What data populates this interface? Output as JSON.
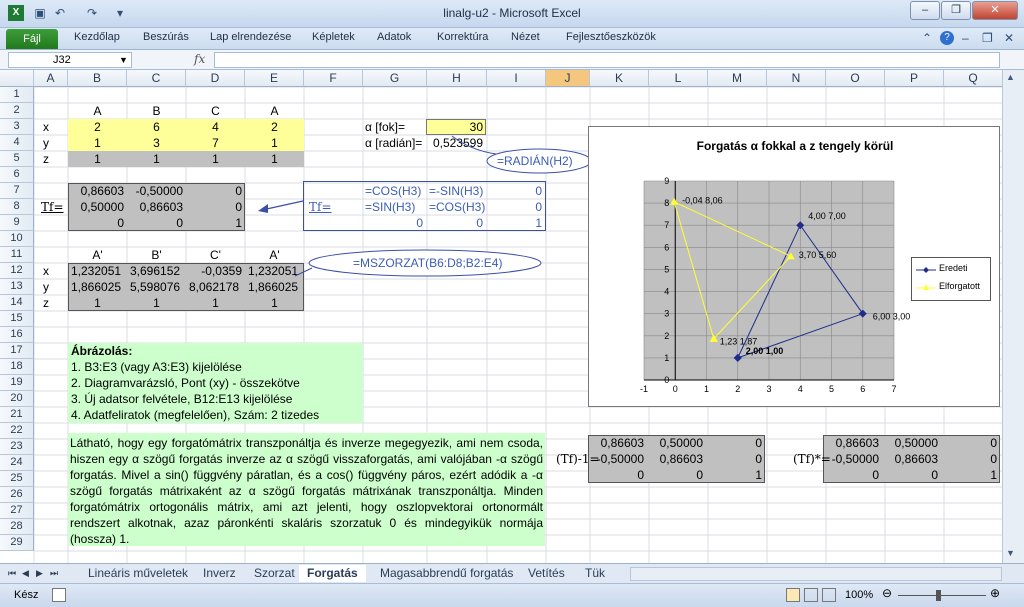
{
  "window": {
    "title": "linalg-u2 - Microsoft Excel"
  },
  "ribbon": {
    "file": "Fájl",
    "tabs": [
      "Kezdőlap",
      "Beszúrás",
      "Lap elrendezése",
      "Képletek",
      "Adatok",
      "Korrektúra",
      "Nézet",
      "Fejlesztőeszközök"
    ]
  },
  "formula_bar": {
    "name_box": "J32",
    "fx": "fx",
    "formula": ""
  },
  "columns": [
    "A",
    "B",
    "C",
    "D",
    "E",
    "F",
    "G",
    "H",
    "I",
    "J",
    "K",
    "L",
    "M",
    "N",
    "O",
    "P",
    "Q"
  ],
  "rows": [
    "1",
    "2",
    "3",
    "4",
    "5",
    "6",
    "7",
    "8",
    "9",
    "10",
    "11",
    "12",
    "13",
    "14",
    "15",
    "16",
    "17",
    "18",
    "19",
    "20",
    "21",
    "22",
    "23",
    "24",
    "25",
    "26",
    "27",
    "28",
    "29"
  ],
  "cells": {
    "hdr": [
      "A",
      "B",
      "C",
      "A"
    ],
    "r3": [
      "x",
      "2",
      "6",
      "4",
      "2"
    ],
    "r4": [
      "y",
      "1",
      "3",
      "7",
      "1"
    ],
    "r5": [
      "z",
      "1",
      "1",
      "1",
      "1"
    ],
    "alpha_deg_label": "α [fok]=",
    "alpha_deg": "30",
    "alpha_rad_label": "α [radián]=",
    "alpha_rad": "0,523599",
    "r7": [
      "0,86603",
      "-0,50000",
      "0"
    ],
    "r8": [
      "0,50000",
      "0,86603",
      "0"
    ],
    "r9": [
      "0",
      "0",
      "1"
    ],
    "mat_label": "Tf=",
    "f7": [
      "=COS(H3)",
      "=-SIN(H3)",
      "0"
    ],
    "f8": [
      "=SIN(H3)",
      "=COS(H3)",
      "0"
    ],
    "f9": [
      "0",
      "0",
      "1"
    ],
    "hdr2": [
      "A'",
      "B'",
      "C'",
      "A'"
    ],
    "r12": [
      "x",
      "1,232051",
      "3,696152",
      "-0,0359",
      "1,232051"
    ],
    "r13": [
      "y",
      "1,866025",
      "5,598076",
      "8,062178",
      "1,866025"
    ],
    "r14": [
      "z",
      "1",
      "1",
      "1",
      "1"
    ],
    "callout1": "=RADIÁN(H2)",
    "callout2": "=MSZORZAT(B6:D8;B2:E4)",
    "plot_title": "Ábrázolás:",
    "plot_steps": [
      "1. B3:E3 (vagy A3:E3) kijelölése",
      "2. Diagramvarázsló, Pont (xy) - összekötve",
      "3. Új adatsor felvétele, B12:E13 kijelölése",
      "4. Adatfeliratok (megfelelően), Szám: 2 tizedes"
    ],
    "paragraph": "Látható, hogy egy forgatómátrix transzponáltja és inverze megegyezik, ami nem csoda, hiszen egy α szögű forgatás inverze az α szögű visszaforgatás, ami valójában -α szögű forgatás. Mivel a sin() függvény páratlan, és a cos() függvény páros, ezért adódik a -α szögű forgatás mátrixaként az α szögű forgatás mátrixának transzponáltja. Minden forgatómátrix ortogonális mátrix, ami azt jelenti, hogy oszlopvektorai ortonormált rendszert alkotnak, azaz páronkénti skaláris szorzatuk 0 és mindegyikük normája (hossza) 1.",
    "inv_label": "(Tf)-1=",
    "tr_label": "(Tf)*=",
    "inv": [
      [
        "0,86603",
        "0,50000",
        "0"
      ],
      [
        "-0,50000",
        "0,86603",
        "0"
      ],
      [
        "0",
        "0",
        "1"
      ]
    ],
    "tr": [
      [
        "0,86603",
        "0,50000",
        "0"
      ],
      [
        "-0,50000",
        "0,86603",
        "0"
      ],
      [
        "0",
        "0",
        "1"
      ]
    ]
  },
  "chart_data": {
    "type": "scatter",
    "title": "Forgatás α fokkal a z tengely körül",
    "xlim": [
      -1,
      7
    ],
    "ylim": [
      0,
      9
    ],
    "xticks": [
      -1,
      0,
      1,
      2,
      3,
      4,
      5,
      6,
      7
    ],
    "yticks": [
      0,
      1,
      2,
      3,
      4,
      5,
      6,
      7,
      8,
      9
    ],
    "legend": "right",
    "series": [
      {
        "name": "Eredeti",
        "color": "#1f2d8c",
        "x": [
          2,
          6,
          4,
          2
        ],
        "y": [
          1,
          3,
          7,
          1
        ],
        "labels": [
          "2,00 1,00",
          "6,00 3,00",
          "4,00 7,00",
          ""
        ]
      },
      {
        "name": "Elforgatott",
        "color": "#ffff33",
        "x": [
          1.232051,
          3.696152,
          -0.0359,
          1.232051
        ],
        "y": [
          1.866025,
          5.598076,
          8.062178,
          1.866025
        ],
        "labels": [
          "1,23 1,87",
          "3,70 5,60",
          "-0,04 8,06",
          ""
        ]
      }
    ]
  },
  "sheets": [
    "Lineáris műveletek",
    "Inverz",
    "Szorzat",
    "Forgatás",
    "Magasabbrendű forgatás",
    "Vetítés",
    "Tük"
  ],
  "active_sheet": "Forgatás",
  "status": {
    "ready": "Kész",
    "zoom": "100%"
  },
  "colors": {
    "yellow": "#ffff99",
    "gray": "#c0c0c0",
    "green": "#ccffcc",
    "sel_col": "#f5c77e"
  }
}
